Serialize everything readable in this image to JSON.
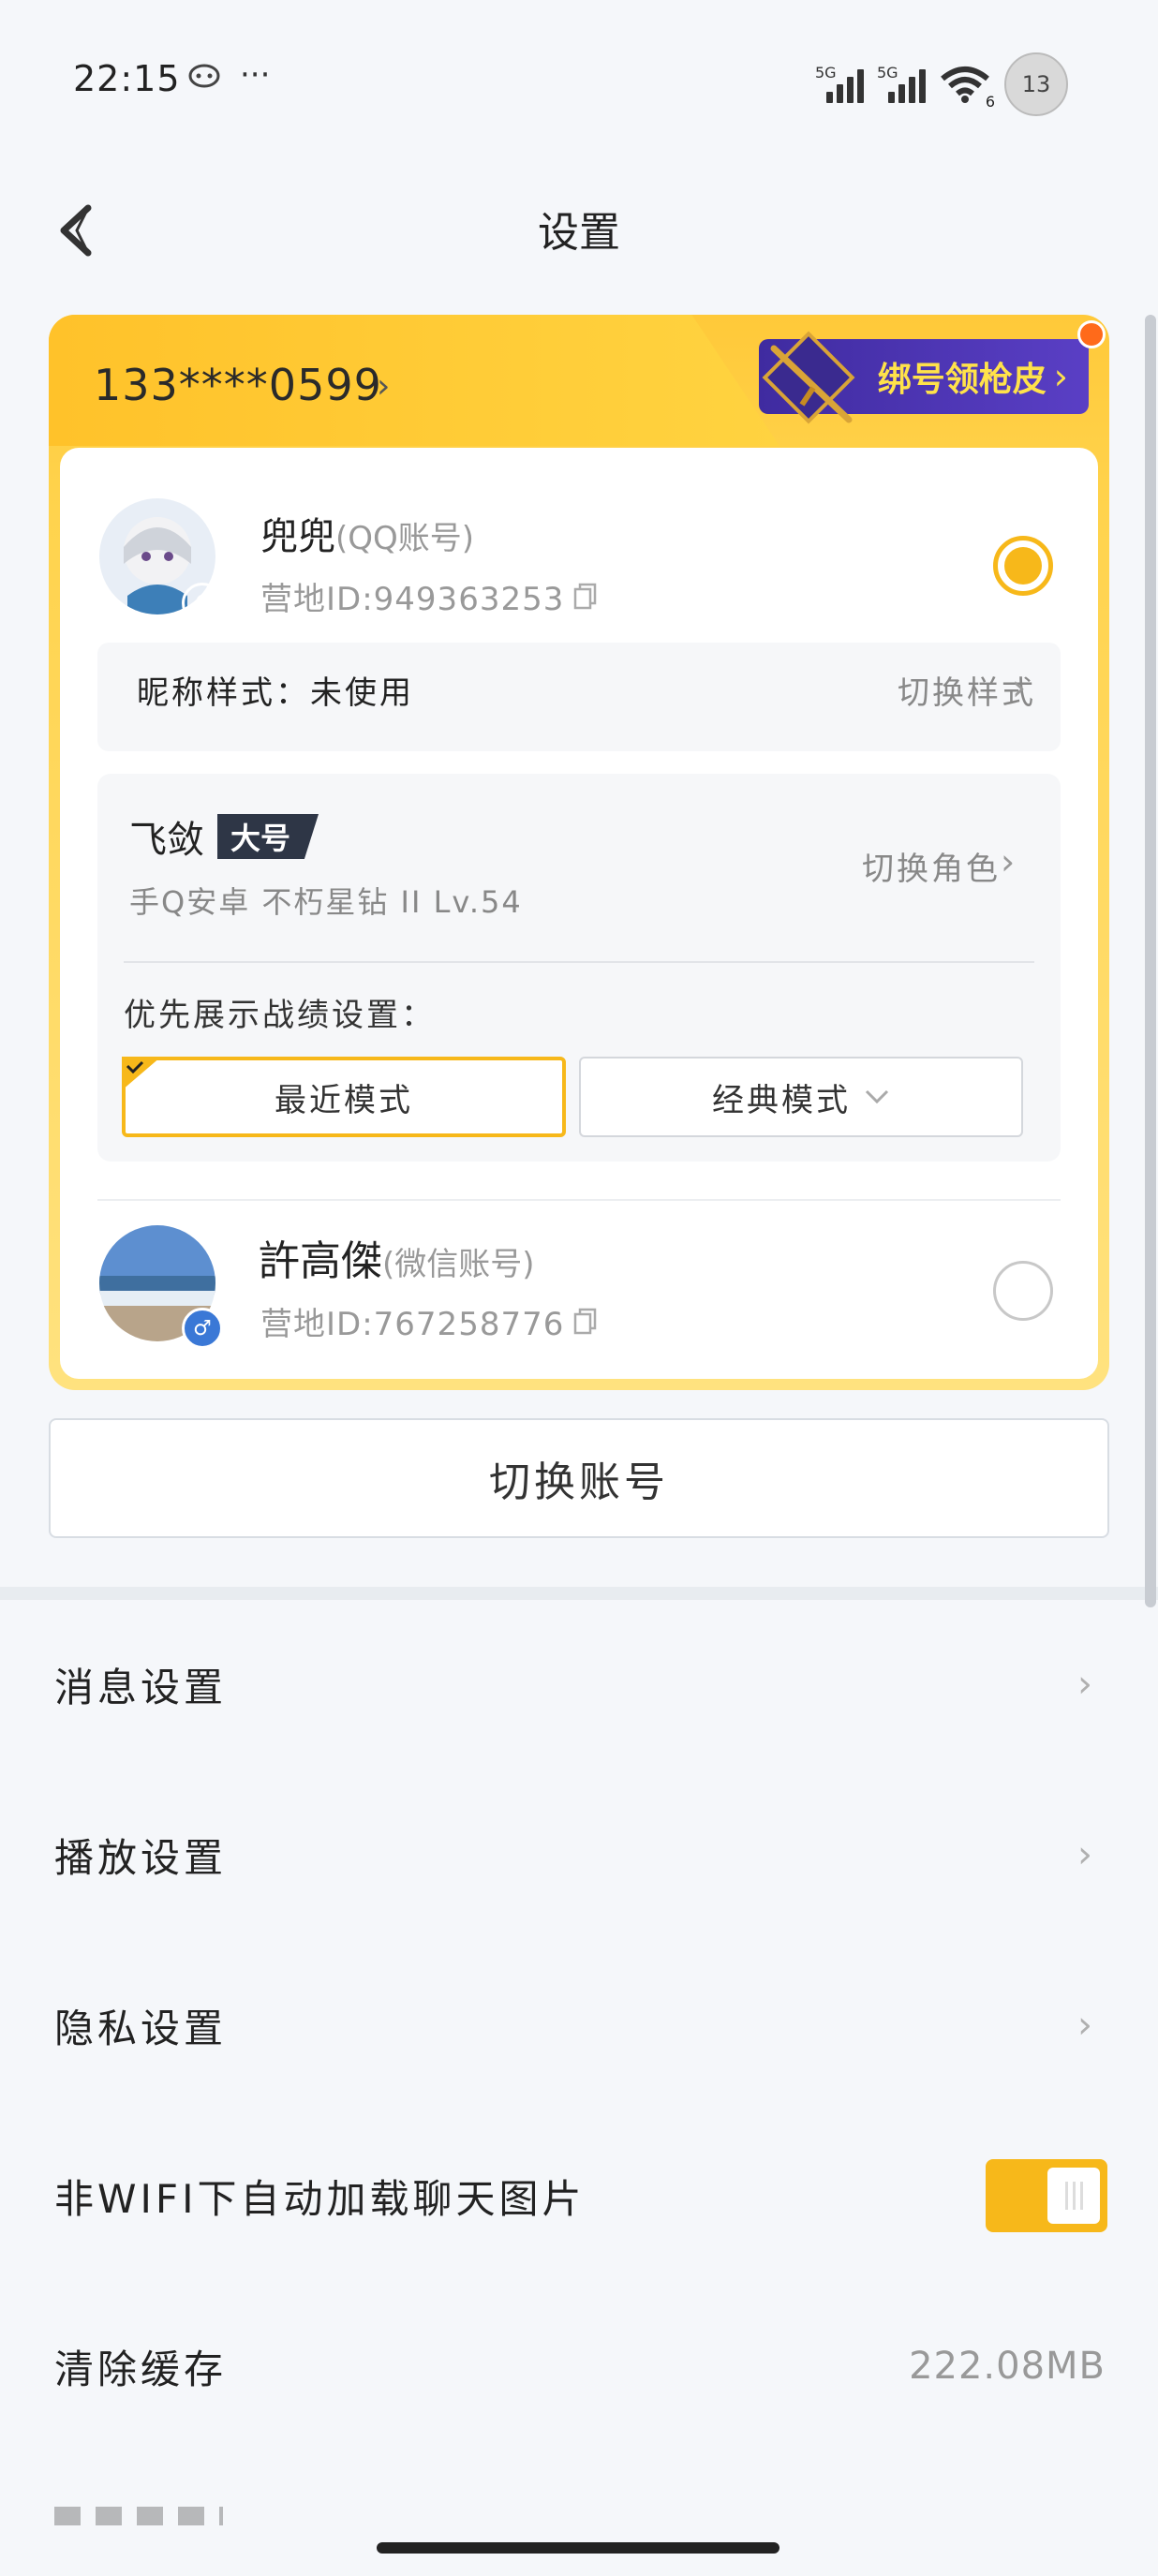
{
  "status_bar": {
    "time": "22:15",
    "more_dots": "···",
    "signal1_tag": "5G",
    "signal2_tag": "5G",
    "wifi_tag": "6",
    "badge_text": "13"
  },
  "header": {
    "title": "设置"
  },
  "card": {
    "phone": "133****0599",
    "skin_banner": "绑号领枪皮",
    "accounts": [
      {
        "name": "兜兜",
        "type": "(QQ账号)",
        "id_label": "营地ID:949363253",
        "selected": true,
        "gender": "♀",
        "gender_color": "#f06ba8"
      },
      {
        "name": "許高傑",
        "type": "(微信账号)",
        "id_label": "营地ID:767258776",
        "selected": false,
        "gender": "♂",
        "gender_color": "#3a78d6"
      }
    ],
    "nickname_style": {
      "label": "昵称样式：",
      "value": "未使用",
      "action": "切换样式"
    },
    "role": {
      "name": "飞敛",
      "tag": "大号",
      "detail": "手Q安卓  不朽星钻 II  Lv.54",
      "action": "切换角色",
      "priority_label": "优先展示战绩设置：",
      "mode_recent": "最近模式",
      "mode_classic": "经典模式"
    }
  },
  "switch_account": "切换账号",
  "settings": [
    {
      "label": "消息设置"
    },
    {
      "label": "播放设置"
    },
    {
      "label": "隐私设置"
    },
    {
      "label": "非WIFI下自动加载聊天图片",
      "toggle": true
    },
    {
      "label": "清除缓存",
      "value": "222.08MB"
    }
  ],
  "colors": {
    "accent": "#f7b81a",
    "banner": "#4a33b0",
    "banner_text": "#ffe24a"
  }
}
